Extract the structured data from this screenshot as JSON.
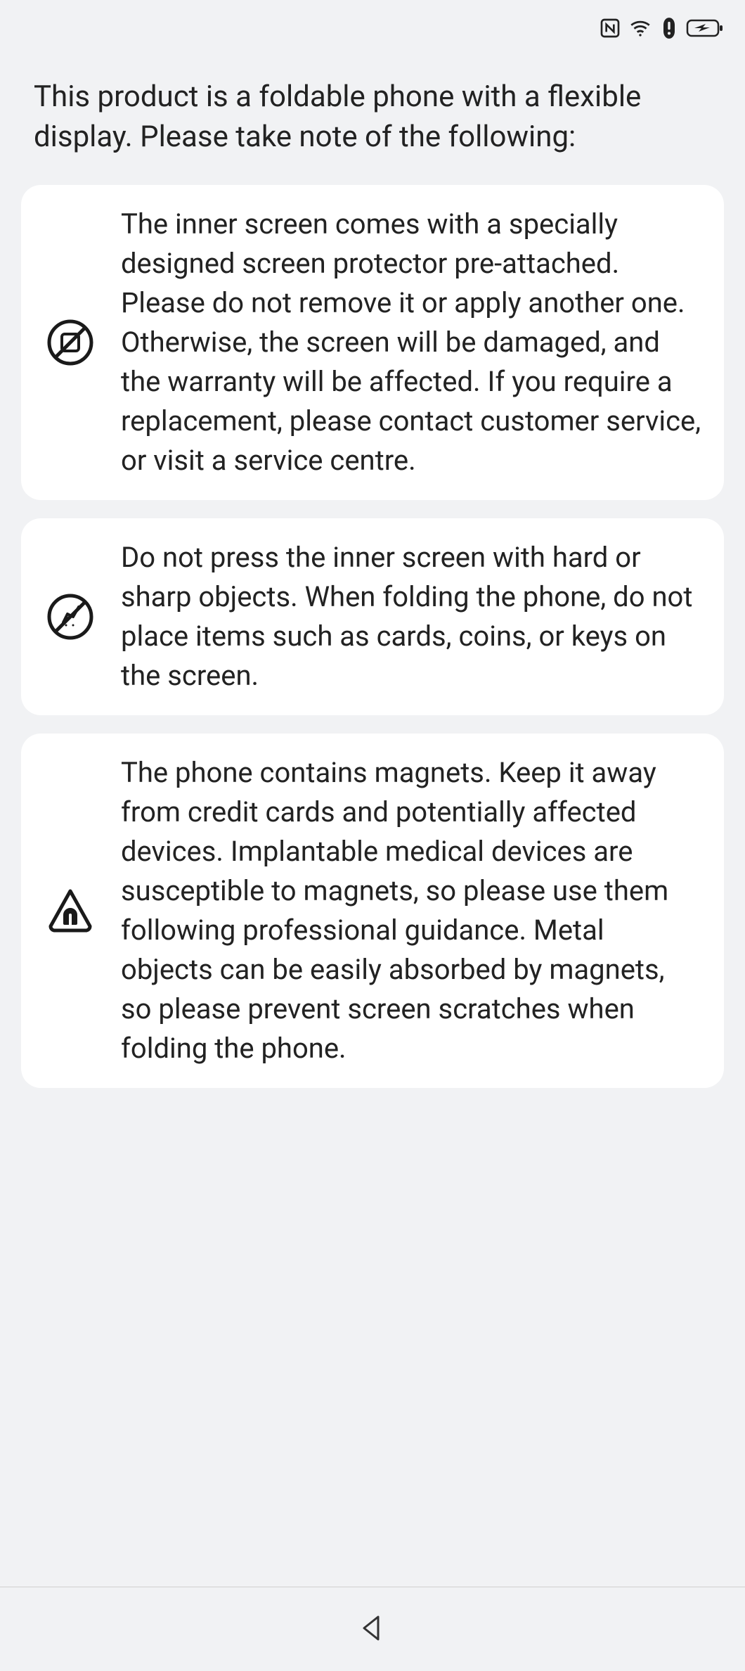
{
  "status": {
    "nfc": "nfc-icon",
    "wifi": "wifi-icon",
    "alert": "alert-icon",
    "battery": "battery-charging-icon"
  },
  "intro": "This product is a foldable phone with a flexible display. Please take note of the following:",
  "cards": [
    {
      "icon": "no-peel-icon",
      "text": "The inner screen comes with a specially designed screen protector pre-attached. Please do not remove it or apply another one. Otherwise, the screen will be damaged, and the warranty will be affected. If you require a replacement, please contact customer service, or visit a service centre."
    },
    {
      "icon": "no-sharp-icon",
      "text": "Do not press the inner screen with hard or sharp objects. When folding the phone, do not place items such as cards, coins, or keys on the screen."
    },
    {
      "icon": "magnet-warning-icon",
      "text": "The phone contains magnets. Keep it away from credit cards and potentially affected devices. Implantable medical devices are susceptible to magnets, so please use them following professional guidance. Metal objects can be easily absorbed by magnets, so please prevent screen scratches when folding the phone."
    }
  ],
  "nav": {
    "back": "back-button"
  }
}
